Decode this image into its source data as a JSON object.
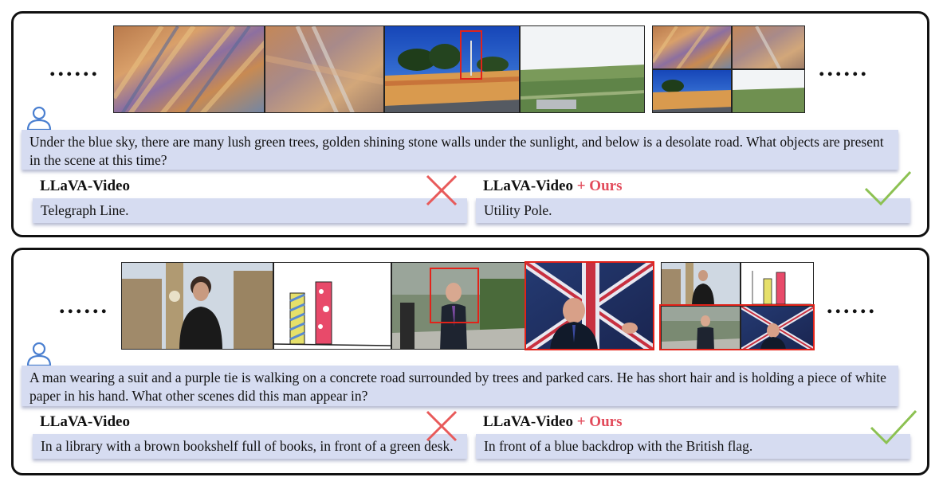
{
  "ellipsis": "......",
  "examples": [
    {
      "question": "Under the blue sky, there are many lush green trees, golden shining stone walls under the sunlight, and below is a desolate road. What objects are present in the scene at this time?",
      "baseline": {
        "name": "LLaVA-Video",
        "answer": "Telegraph Line."
      },
      "ours": {
        "name": "LLaVA-Video",
        "suffix": " + Ours",
        "answer": "Utility Pole."
      }
    },
    {
      "question": "A man wearing a suit and a purple tie is walking on a concrete road surrounded by trees and parked cars. He has short hair and is holding a piece of white paper in his hand. What other scenes did this man appear in?",
      "baseline": {
        "name": "LLaVA-Video",
        "answer": "In a library with a brown bookshelf full of books, in front of a green desk."
      },
      "ours": {
        "name": "LLaVA-Video",
        "suffix": " + Ours",
        "answer": "In front of a blue backdrop with the British flag."
      }
    }
  ],
  "colors": {
    "accent": "#e24a5a",
    "box": "#d6dcf1",
    "highlight": "#e2231a",
    "check": "#8cc152",
    "cross": "#e85a5a",
    "user_icon": "#4a7fd0"
  }
}
